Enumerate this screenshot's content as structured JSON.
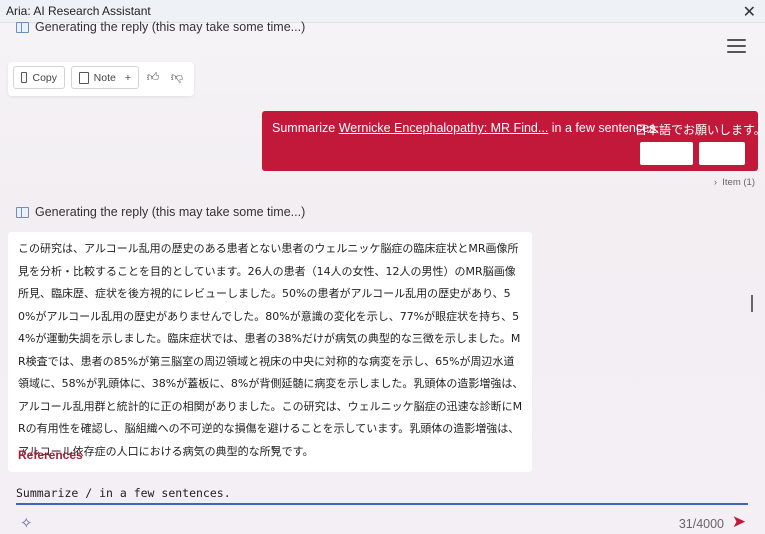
{
  "window": {
    "title": "Aria: AI Research Assistant",
    "close_icon": "close-icon"
  },
  "status_top": {
    "text": "Generating the reply (this may take some time...)",
    "icon": "book-icon"
  },
  "actions": {
    "copy_label": "Copy",
    "note_label": "Note",
    "note_plus": "+",
    "thumb_up_icon": "thumbs-up-icon",
    "thumb_down_icon": "thumbs-down-icon"
  },
  "user_message": {
    "prefix": "Summarize",
    "link": "Wernicke Encephalopathy: MR Find...",
    "suffix": "in a few sentences.",
    "jp_request": "日本語でお願いします。",
    "color": "#c2193b"
  },
  "item_count": "Item (1)",
  "status_mid": {
    "text": "Generating the reply (this may take some time...)",
    "icon": "book-icon"
  },
  "answer": {
    "text": "この研究は、アルコール乱用の歴史のある患者とない患者のウェルニッケ脳症の臨床症状とMR画像所見を分析・比較することを目的としています。26人の患者（14人の女性、12人の男性）のMR脳画像所見、臨床歴、症状を後方視的にレビューしました。50%の患者がアルコール乱用の歴史があり、50%がアルコール乱用の歴史がありませんでした。80%が意識の変化を示し、77%が眼症状を持ち、54%が運動失調を示しました。臨床症状では、患者の38%だけが病気の典型的な三徴を示しました。MR検査では、患者の85%が第三脳室の周辺領域と視床の中央に対称的な病変を示し、65%が周辺水道領域に、58%が乳頭体に、38%が蓋板に、8%が背側延髄に病変を示しました。乳頭体の造影増強は、アルコール乱用群と統計的に正の相関がありました。この研究は、ウェルニッケ脳症の迅速な診断にMRの有用性を確認し、脳組織への不可逆的な損傷を避けることを示しています。乳頭体の造影増強は、アルコール依存症の人口における病気の典型的な所見です。",
    "references_label": "References"
  },
  "input": {
    "value": "Summarize / in a few sentences.",
    "counter": "31/4000",
    "sparkle_icon": "sparkle-icon",
    "send_icon": "send-icon"
  }
}
